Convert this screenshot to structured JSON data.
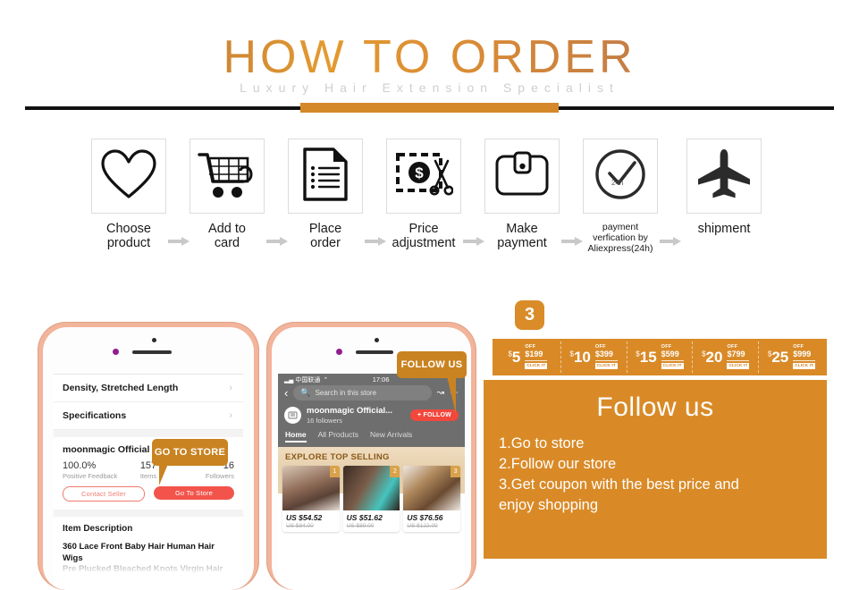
{
  "header": {
    "title": "HOW TO ORDER",
    "subtitle": "Luxury Hair Extension Specialist"
  },
  "steps": [
    {
      "icon": "heart-icon",
      "label": "Choose\nproduct"
    },
    {
      "icon": "shopping-cart-icon",
      "label": "Add to\ncard"
    },
    {
      "icon": "document-icon",
      "label": "Place\norder"
    },
    {
      "icon": "price-scissors-icon",
      "label": "Price\nadjustment"
    },
    {
      "icon": "wallet-icon",
      "label": "Make\npayment"
    },
    {
      "icon": "clock-check-icon",
      "label": "payment\nverfication by\nAliexpress(24h)"
    },
    {
      "icon": "airplane-icon",
      "label": "shipment"
    }
  ],
  "phone_one": {
    "rows": [
      {
        "label": "Density, Stretched Length",
        "chevron": "›"
      },
      {
        "label": "Specifications",
        "chevron": "›"
      }
    ],
    "store_name": "moonmagic Official Store",
    "stats": [
      {
        "value": "100.0%",
        "label": "Positive Feedback"
      },
      {
        "value": "157",
        "label": "Items"
      },
      {
        "value": "16",
        "label": "Followers"
      }
    ],
    "buttons": {
      "contact_seller": "Contact Seller",
      "go_to_store": "Go To Store"
    },
    "description_heading": "Item Description",
    "description_body": "360 Lace Front Baby Hair Human Hair Wigs",
    "description_body_fade": "Pre Plucked Bleached Knots Virgin Hair",
    "callout": "GO TO STORE"
  },
  "phone_two": {
    "status_carrier": "中国联通",
    "status_time": "17:06",
    "search_placeholder": "Search in this store",
    "store_name": "moonmagic Official...",
    "store_followers": "16 followers",
    "follow_button": "+ FOLLOW",
    "tabs": [
      {
        "label": "Home",
        "active": true
      },
      {
        "label": "All Products",
        "active": false
      },
      {
        "label": "New Arrivals",
        "active": false
      }
    ],
    "section_title": "EXPLORE TOP SELLING",
    "products": [
      {
        "rank": "1",
        "price": "US $54.52",
        "original_price": "US $84.00"
      },
      {
        "rank": "2",
        "price": "US $51.62",
        "original_price": "US $89.00"
      },
      {
        "rank": "3",
        "price": "US $76.56",
        "original_price": "US $122.00"
      }
    ],
    "callout": "FOLLOW US"
  },
  "right_panel": {
    "badge": "3",
    "coupons": [
      {
        "amount": "5",
        "currency": "$",
        "off": "OFF",
        "min": "$199",
        "cta": "CLICK IT"
      },
      {
        "amount": "10",
        "currency": "$",
        "off": "OFF",
        "min": "$399",
        "cta": "CLICK IT"
      },
      {
        "amount": "15",
        "currency": "$",
        "off": "OFF",
        "min": "$599",
        "cta": "CLICK IT"
      },
      {
        "amount": "20",
        "currency": "$",
        "off": "OFF",
        "min": "$799",
        "cta": "CLICK IT"
      },
      {
        "amount": "25",
        "currency": "$",
        "off": "OFF",
        "min": "$999",
        "cta": "CLICK IT"
      }
    ],
    "follow_title": "Follow us",
    "follow_steps": [
      "1.Go to store",
      "2.Follow our store",
      "3.Get coupon with the best price and",
      " enjoy shopping"
    ]
  },
  "colors": {
    "accent_orange": "#d98a27",
    "title_orange": "#c07a3a",
    "callout_orange": "#c98321",
    "red": "#f2544b",
    "phone_frame": "#f2b49a"
  }
}
